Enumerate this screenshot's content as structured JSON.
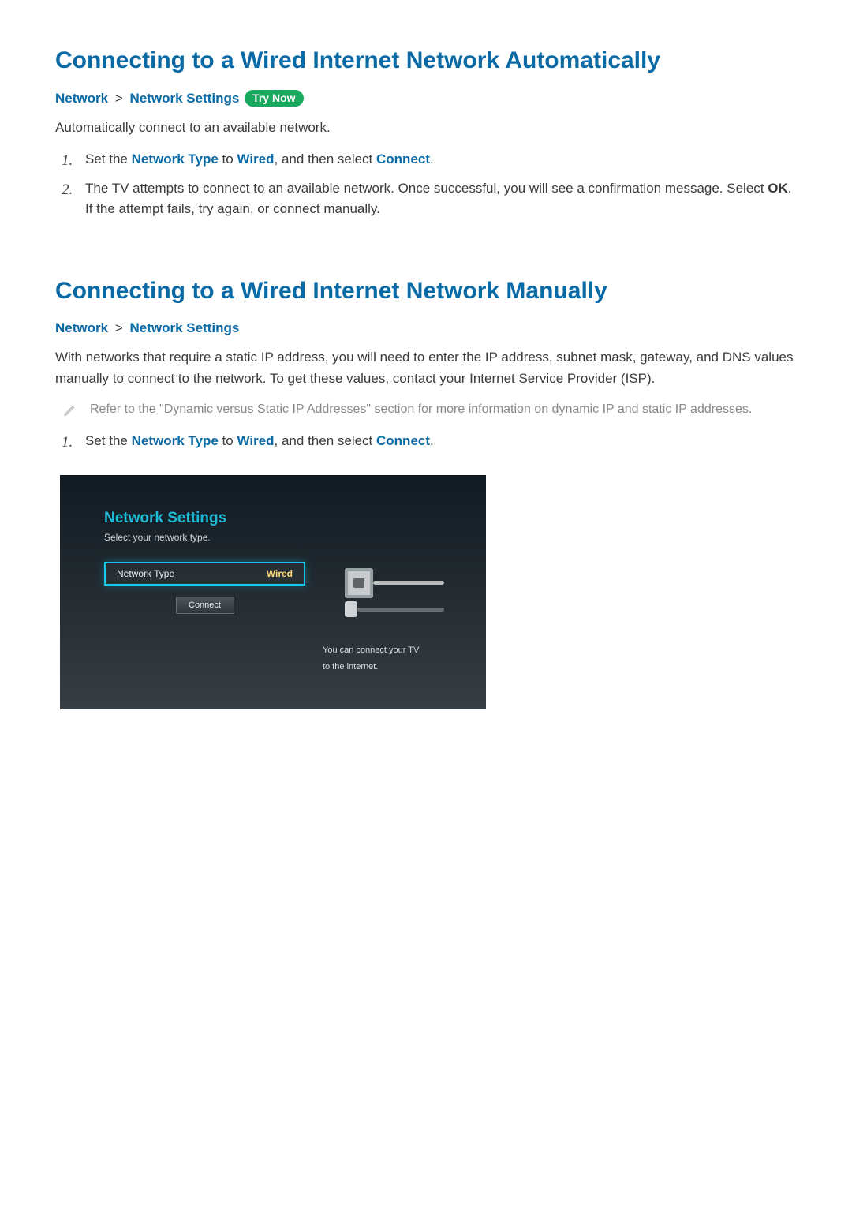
{
  "section_auto": {
    "title": "Connecting to a Wired Internet Network Automatically",
    "breadcrumb": {
      "a": "Network",
      "b": "Network Settings",
      "sep": ">"
    },
    "try_now": "Try Now",
    "intro": "Automatically connect to an available network.",
    "steps": [
      {
        "marker": "1.",
        "prefix": "Set the ",
        "hl1": "Network Type",
        "mid1": " to ",
        "hl2": "Wired",
        "mid2": ", and then select ",
        "hl3": "Connect",
        "suffix": "."
      },
      {
        "marker": "2.",
        "prefix": "The TV attempts to connect to an available network. Once successful, you will see a confirmation message. Select ",
        "hl1": "OK",
        "suffix": ". If the attempt fails, try again, or connect manually."
      }
    ]
  },
  "section_manual": {
    "title": "Connecting to a Wired Internet Network Manually",
    "breadcrumb": {
      "a": "Network",
      "b": "Network Settings",
      "sep": ">"
    },
    "intro": "With networks that require a static IP address, you will need to enter the IP address, subnet mask, gateway, and DNS values manually to connect to the network. To get these values, contact your Internet Service Provider (ISP).",
    "note": "Refer to the \"Dynamic versus Static IP Addresses\" section for more information on dynamic IP and static IP addresses.",
    "steps": [
      {
        "marker": "1.",
        "prefix": "Set the ",
        "hl1": "Network Type",
        "mid1": " to ",
        "hl2": "Wired",
        "mid2": ", and then select ",
        "hl3": "Connect",
        "suffix": "."
      }
    ]
  },
  "tv_panel": {
    "title": "Network Settings",
    "subtitle": "Select your network type.",
    "field_label": "Network Type",
    "field_value": "Wired",
    "connect": "Connect",
    "info_line1": "You can connect your TV",
    "info_line2": "to the internet."
  }
}
